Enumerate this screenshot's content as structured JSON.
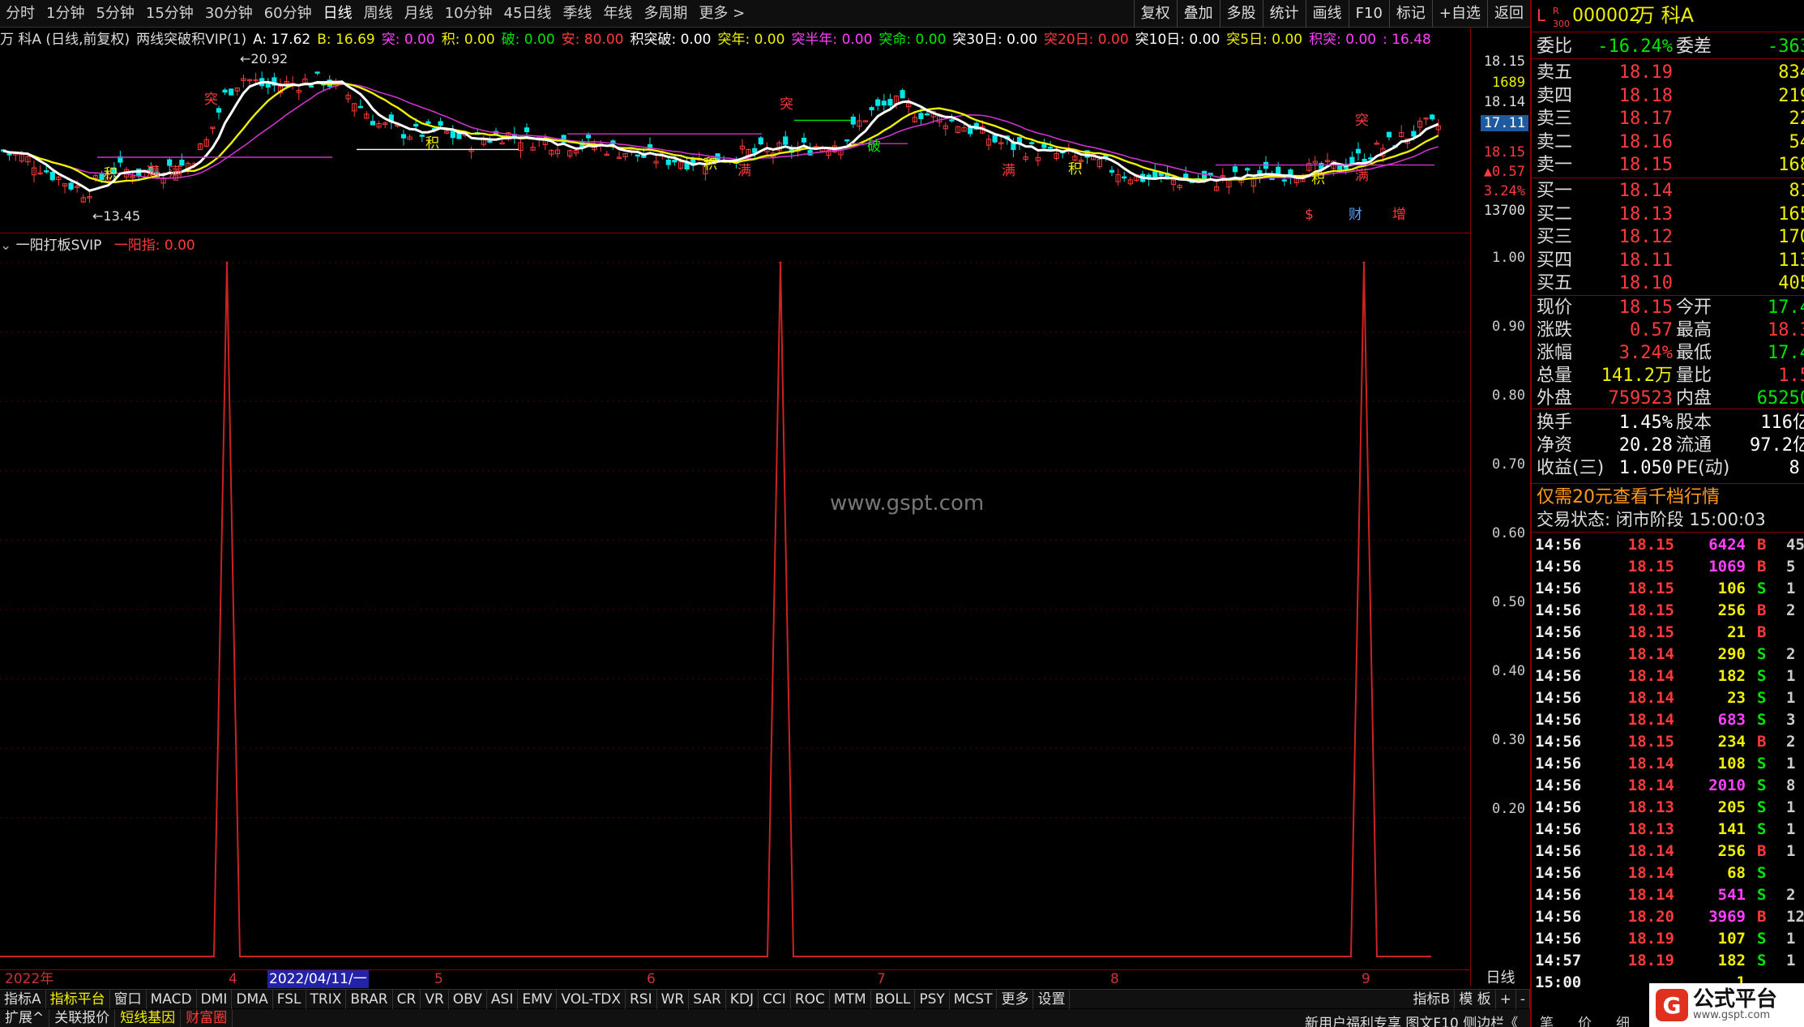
{
  "periods": [
    "分时",
    "1分钟",
    "5分钟",
    "15分钟",
    "30分钟",
    "60分钟",
    "日线",
    "周线",
    "月线",
    "10分钟",
    "45日线",
    "季线",
    "年线",
    "多周期",
    "更多 >"
  ],
  "toolbar_right": [
    "复权",
    "叠加",
    "多股",
    "统计",
    "画线",
    "F10",
    "标记",
    "+自选",
    "返回"
  ],
  "main_info": {
    "stock": "万 科A (日线,前复权)",
    "formula": "两线突破积VIP(1)",
    "a": "A: 17.62",
    "b": "B: 16.69",
    "tu": "突: 0.00",
    "ji": "积: 0.00",
    "po": "破: 0.00",
    "an": "安: 80.00",
    "jitupo": "积突破: 0.00",
    "tunian": "突年: 0.00",
    "tubannian": "突半年: 0.00",
    "tuming": "突命: 0.00",
    "tu30": "突30日: 0.00",
    "tu20": "突20日: 0.00",
    "tu10": "突10日: 0.00",
    "tu5": "突5日: 0.00",
    "jitu": "积突: 0.00",
    "last": ": 16.48"
  },
  "chart_annotations": {
    "high": "20.92",
    "low": "13.45",
    "markers": [
      "积",
      "满",
      "满",
      "突",
      "积",
      "积",
      "满",
      "突",
      "破",
      "满",
      "积",
      "积",
      "满",
      "突",
      "$",
      "财",
      "增"
    ]
  },
  "price_axis": {
    "p1": "18.15",
    "vol": "1689",
    "p2": "18.14",
    "cur": "17.11",
    "close": "18.15",
    "chg": "▲0.57",
    "pct": "3.24%",
    "v2": "13700"
  },
  "indicator_info": {
    "name": "一阳打板SVIP",
    "value": "一阳指: 0.00"
  },
  "indicator_axis": [
    "1.00",
    "0.90",
    "0.80",
    "0.70",
    "0.60",
    "0.50",
    "0.40",
    "0.30",
    "0.20"
  ],
  "watermark": "www.gspt.com",
  "chart_data": {
    "type": "line",
    "title": "一阳打板SVIP",
    "series": [
      {
        "name": "一阳指",
        "x": [
          "2022/04/11",
          "2022/06",
          "2022/09"
        ],
        "values": [
          1,
          1,
          1
        ]
      }
    ],
    "ylim": [
      0,
      1
    ],
    "date_labels": [
      "2022年",
      "4",
      "2022/04/11/一",
      "5",
      "6",
      "7",
      "8",
      "9"
    ]
  },
  "day_label": "日线",
  "ind_tabs": [
    "指标A",
    "指标平台",
    "窗口",
    "MACD",
    "DMI",
    "DMA",
    "FSL",
    "TRIX",
    "BRAR",
    "CR",
    "VR",
    "OBV",
    "ASI",
    "EMV",
    "VOL-TDX",
    "RSI",
    "WR",
    "SAR",
    "KDJ",
    "CCI",
    "ROC",
    "MTM",
    "BOLL",
    "PSY",
    "MCST",
    "更多",
    "设置"
  ],
  "ind_tabs_right": [
    "指标B",
    "模 板",
    "+",
    "-"
  ],
  "bottom_tabs": [
    "扩展^",
    "关联报价",
    "短线基因",
    "财富圈"
  ],
  "bottom_news": "新用户福利专享 图文F10 侧边栏《",
  "quote": {
    "code": "000002",
    "name": "万 科A",
    "L": "L",
    "R": "R",
    "n300": "300",
    "weibi_label": "委比",
    "weibi": "-16.24%",
    "weicha_label": "委差",
    "weicha": "-363",
    "asks": [
      {
        "l": "卖五",
        "p": "18.19",
        "v": "834"
      },
      {
        "l": "卖四",
        "p": "18.18",
        "v": "219"
      },
      {
        "l": "卖三",
        "p": "18.17",
        "v": "22"
      },
      {
        "l": "卖二",
        "p": "18.16",
        "v": "54"
      },
      {
        "l": "卖一",
        "p": "18.15",
        "v": "168"
      }
    ],
    "bids": [
      {
        "l": "买一",
        "p": "18.14",
        "v": "81"
      },
      {
        "l": "买二",
        "p": "18.13",
        "v": "165"
      },
      {
        "l": "买三",
        "p": "18.12",
        "v": "170"
      },
      {
        "l": "买四",
        "p": "18.11",
        "v": "113"
      },
      {
        "l": "买五",
        "p": "18.10",
        "v": "405"
      }
    ],
    "stats": [
      {
        "a": "现价",
        "b": "18.15",
        "c": "今开",
        "d": "17.4"
      },
      {
        "a": "涨跌",
        "b": "0.57",
        "c": "最高",
        "d": "18.3"
      },
      {
        "a": "涨幅",
        "b": "3.24%",
        "c": "最低",
        "d": "17.4"
      },
      {
        "a": "总量",
        "b": "141.2万",
        "c": "量比",
        "d": "1.5"
      },
      {
        "a": "外盘",
        "b": "759523",
        "c": "内盘",
        "d": "65250"
      }
    ],
    "stats2": [
      {
        "a": "换手",
        "b": "1.45%",
        "c": "股本",
        "d": "116亿"
      },
      {
        "a": "净资",
        "b": "20.28",
        "c": "流通",
        "d": "97.2亿"
      },
      {
        "a": "收益(三)",
        "b": "1.050",
        "c": "PE(动)",
        "d": "8."
      }
    ],
    "promo": "仅需20元查看千档行情",
    "status": "交易状态: 闭市阶段 15:00:03",
    "ticks": [
      {
        "t": "14:56",
        "p": "18.15",
        "v": "6424",
        "s": "B",
        "n": "45"
      },
      {
        "t": "14:56",
        "p": "18.15",
        "v": "1069",
        "s": "B",
        "n": "5"
      },
      {
        "t": "14:56",
        "p": "18.15",
        "v": "106",
        "s": "S",
        "n": "1"
      },
      {
        "t": "14:56",
        "p": "18.15",
        "v": "256",
        "s": "B",
        "n": "2"
      },
      {
        "t": "14:56",
        "p": "18.15",
        "v": "21",
        "s": "B",
        "n": ""
      },
      {
        "t": "14:56",
        "p": "18.14",
        "v": "290",
        "s": "S",
        "n": "2"
      },
      {
        "t": "14:56",
        "p": "18.14",
        "v": "182",
        "s": "S",
        "n": "1"
      },
      {
        "t": "14:56",
        "p": "18.14",
        "v": "23",
        "s": "S",
        "n": "1"
      },
      {
        "t": "14:56",
        "p": "18.14",
        "v": "683",
        "s": "S",
        "n": "3"
      },
      {
        "t": "14:56",
        "p": "18.15",
        "v": "234",
        "s": "B",
        "n": "2"
      },
      {
        "t": "14:56",
        "p": "18.14",
        "v": "108",
        "s": "S",
        "n": "1"
      },
      {
        "t": "14:56",
        "p": "18.14",
        "v": "2010",
        "s": "S",
        "n": "8"
      },
      {
        "t": "14:56",
        "p": "18.13",
        "v": "205",
        "s": "S",
        "n": "1"
      },
      {
        "t": "14:56",
        "p": "18.13",
        "v": "141",
        "s": "S",
        "n": "1"
      },
      {
        "t": "14:56",
        "p": "18.14",
        "v": "256",
        "s": "B",
        "n": "1"
      },
      {
        "t": "14:56",
        "p": "18.14",
        "v": "68",
        "s": "S",
        "n": ""
      },
      {
        "t": "14:56",
        "p": "18.14",
        "v": "541",
        "s": "S",
        "n": "2"
      },
      {
        "t": "14:56",
        "p": "18.20",
        "v": "3969",
        "s": "B",
        "n": "12"
      },
      {
        "t": "14:56",
        "p": "18.19",
        "v": "107",
        "s": "S",
        "n": "1"
      },
      {
        "t": "14:57",
        "p": "18.19",
        "v": "182",
        "s": "S",
        "n": "1"
      },
      {
        "t": "15:00",
        "p": "",
        "v": "1",
        "s": "",
        "n": ""
      }
    ],
    "tabs_bottom": [
      "笔",
      "价",
      "细"
    ]
  },
  "brand": {
    "name": "公式平台",
    "url": "www.gspt.com"
  },
  "colors": {
    "up": "#ff3a3a",
    "down": "#00e600",
    "grid": "#8b0000",
    "ma1": "#ffffff",
    "ma2": "#f0f000",
    "ma3": "#cc33cc"
  }
}
